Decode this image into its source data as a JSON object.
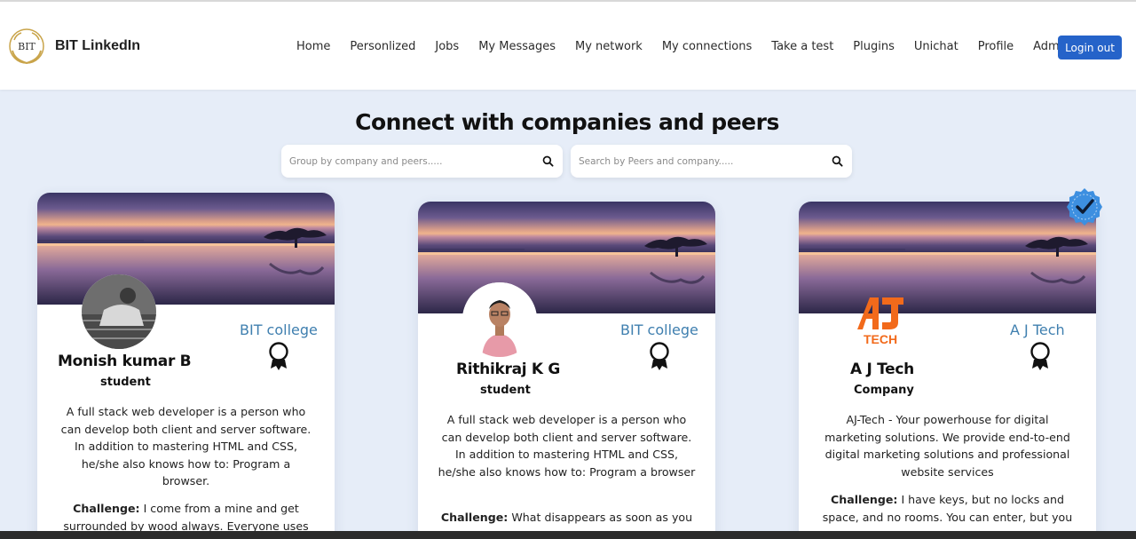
{
  "brand": {
    "logo_text": "BIT",
    "name": "BIT LinkedIn"
  },
  "nav": {
    "links": [
      "Home",
      "Personlized",
      "Jobs",
      "My Messages",
      "My network",
      "My connections",
      "Take a test",
      "Plugins",
      "Unichat",
      "Profile",
      "Admin"
    ],
    "login_label": "Login out"
  },
  "page": {
    "title": "Connect with companies and peers",
    "search_group_placeholder": "Group by company and peers.....",
    "search_peers_placeholder": "Search by Peers and company....."
  },
  "cards": [
    {
      "org": "BIT college",
      "name": "Monish kumar B",
      "role": "student",
      "description": "A full stack web developer is a person who can develop both client and server software. In addition to mastering HTML and CSS, he/she also knows how to: Program a browser.",
      "challenge_label": "Challenge:",
      "challenge_text": "I come from a mine and get surrounded by wood always. Everyone uses"
    },
    {
      "org": "BIT college",
      "name": "Rithikraj K G",
      "role": "student",
      "description": "A full stack web developer is a person who can develop both client and server software. In addition to mastering HTML and CSS, he/she also knows how to: Program a browser",
      "challenge_label": "Challenge:",
      "challenge_text": "What disappears as soon as you"
    },
    {
      "org": "A J Tech",
      "name": "A J Tech",
      "role": "Company",
      "logo_text": "TECH",
      "description": "AJ-Tech - Your powerhouse for digital marketing solutions. We provide end-to-end digital marketing solutions and professional website services",
      "challenge_label": "Challenge:",
      "challenge_text": "I have keys, but no locks and space, and no rooms. You can enter, but you"
    }
  ],
  "colors": {
    "accent": "#2563c9",
    "org_text": "#3f7faf",
    "page_bg": "#e6edf8",
    "verified": "#3d8fe0",
    "logo_orange": "#f26a1b"
  },
  "icons": {
    "search": "search-icon",
    "badge": "award-ribbon-icon",
    "verified": "verified-check-icon"
  }
}
